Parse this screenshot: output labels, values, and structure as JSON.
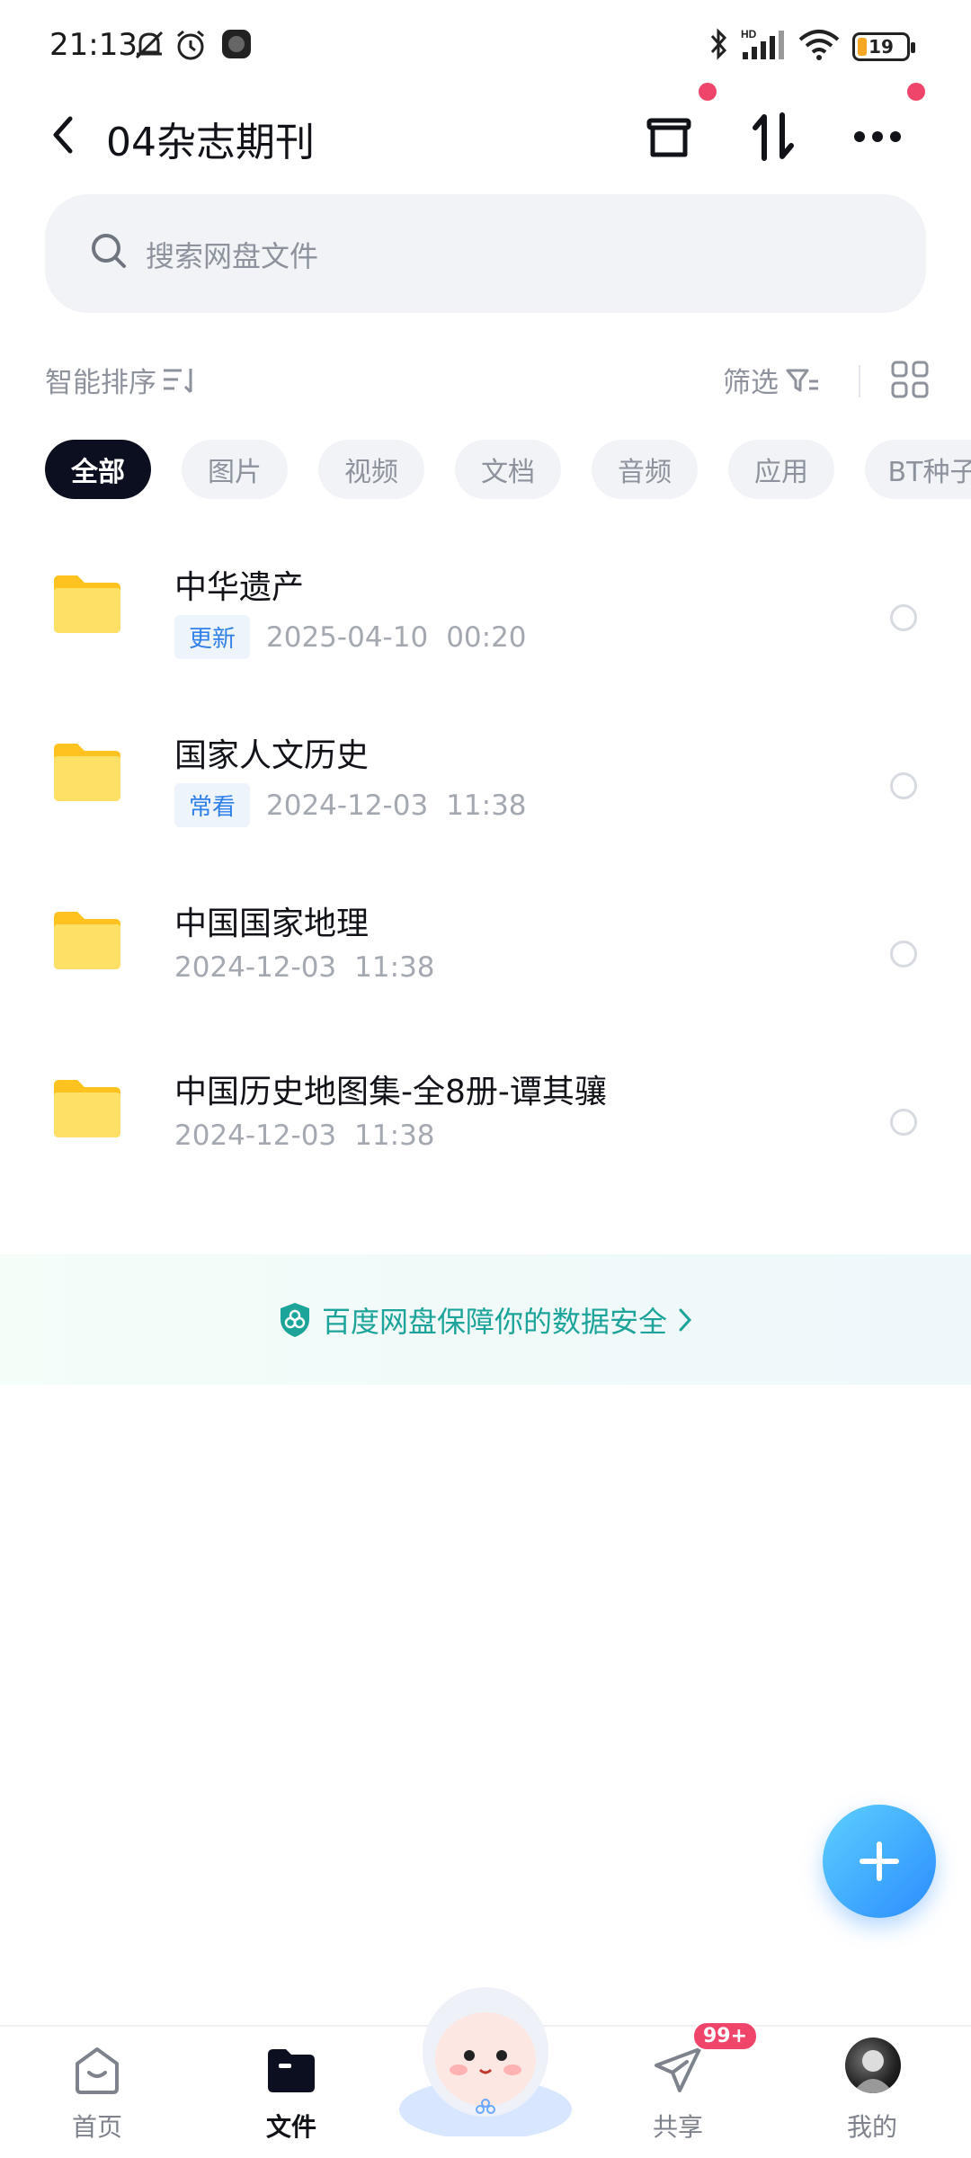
{
  "status_bar": {
    "time": "21:13",
    "battery": "19",
    "network": "HD",
    "signal_sub": "4G",
    "wifi_sub": "6"
  },
  "header": {
    "title": "04杂志期刊"
  },
  "search": {
    "placeholder": "搜索网盘文件"
  },
  "toolbar": {
    "sort_label": "智能排序",
    "filter_label": "筛选"
  },
  "chips": [
    {
      "label": "全部",
      "active": true
    },
    {
      "label": "图片",
      "active": false
    },
    {
      "label": "视频",
      "active": false
    },
    {
      "label": "文档",
      "active": false
    },
    {
      "label": "音频",
      "active": false
    },
    {
      "label": "应用",
      "active": false
    },
    {
      "label": "BT种子",
      "active": false
    }
  ],
  "files": [
    {
      "name": "中华遗产",
      "tag": "更新",
      "date": "2025-04-10",
      "time": "00:20"
    },
    {
      "name": "国家人文历史",
      "tag": "常看",
      "date": "2024-12-03",
      "time": "11:38"
    },
    {
      "name": "中国国家地理",
      "tag": "",
      "date": "2024-12-03",
      "time": "11:38"
    },
    {
      "name": "中国历史地图集-全8册-谭其骧",
      "tag": "",
      "date": "2024-12-03",
      "time": "11:38"
    }
  ],
  "banner": {
    "text": "百度网盘保障你的数据安全"
  },
  "bottom_nav": {
    "home": "首页",
    "files": "文件",
    "share": "共享",
    "share_badge": "99+",
    "mine": "我的"
  },
  "colors": {
    "accent": "#2a8cff",
    "badge": "#f0456a",
    "folder": "#ffd43b",
    "security": "#1ca39a"
  }
}
